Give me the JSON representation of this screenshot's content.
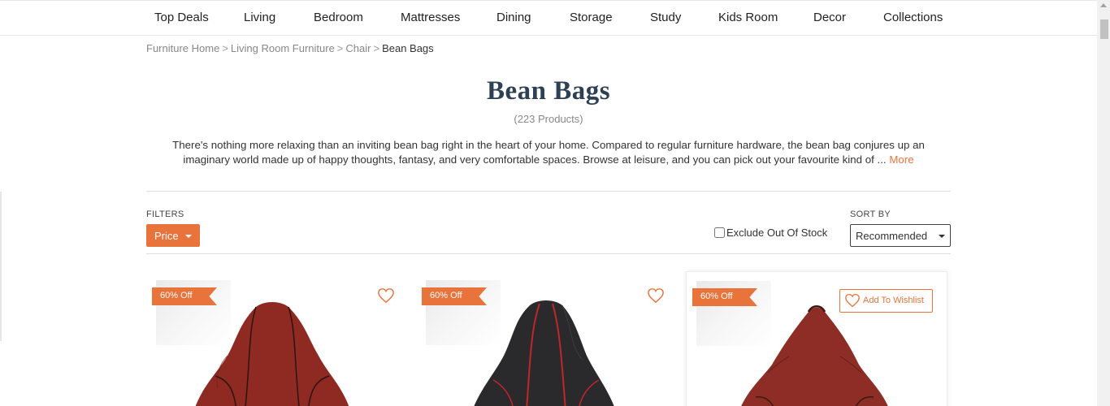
{
  "nav": {
    "items": [
      "Top Deals",
      "Living",
      "Bedroom",
      "Mattresses",
      "Dining",
      "Storage",
      "Study",
      "Kids Room",
      "Decor",
      "Collections"
    ]
  },
  "breadcrumb": {
    "items": [
      "Furniture Home",
      "Living Room Furniture",
      "Chair"
    ],
    "separator": ">",
    "current": "Bean Bags"
  },
  "header": {
    "title": "Bean Bags",
    "count": "(223 Products)",
    "description": "There's nothing more relaxing than an inviting bean bag right in the heart of your home. Compared to regular furniture hardware, the bean bag conjures up an imaginary world made up of happy thoughts, fantasy, and very comfortable spaces. Browse at leisure, and you can pick out your favourite kind of ...",
    "more_label": "More"
  },
  "filters": {
    "label": "FILTERS",
    "price_label": "Price",
    "exclude_label": "Exclude Out Of Stock",
    "exclude_checked": false
  },
  "sort": {
    "label": "SORT BY",
    "selected": "Recommended"
  },
  "products": [
    {
      "badge": "60% Off",
      "color": "#8f2a22",
      "seam": "#2b1410",
      "wishlist": "heart-icon"
    },
    {
      "badge": "60% Off",
      "color": "#2a2a2c",
      "seam": "#c0262b",
      "wishlist": "heart-icon"
    },
    {
      "badge": "60% Off",
      "color": "#8e2d25",
      "seam": "#3a1a14",
      "wishlist_label": "Add To Wishlist"
    }
  ],
  "colors": {
    "accent": "#e8733b",
    "title": "#2e4054"
  }
}
